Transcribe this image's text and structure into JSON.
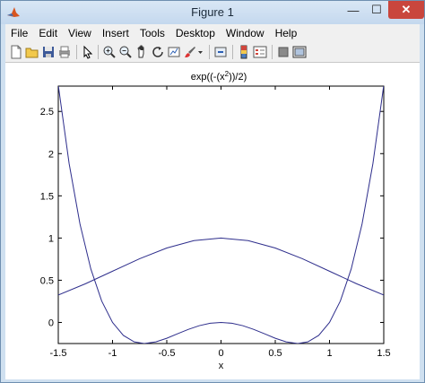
{
  "window": {
    "title": "Figure 1",
    "minimize_symbol": "—",
    "maximize_symbol": "☐",
    "close_symbol": "✕"
  },
  "menu": {
    "items": [
      "File",
      "Edit",
      "View",
      "Insert",
      "Tools",
      "Desktop",
      "Window",
      "Help"
    ]
  },
  "toolbar": {
    "buttons": [
      "new-figure-icon",
      "open-file-icon",
      "save-icon",
      "print-icon",
      "pointer-icon",
      "zoom-in-icon",
      "zoom-out-icon",
      "pan-icon",
      "rotate-icon",
      "data-cursor-icon",
      "brush-icon",
      "brush-dropdown-icon",
      "link-plot-icon",
      "colorbar-icon",
      "legend-icon",
      "hide-plot-tools-icon",
      "show-plot-tools-icon"
    ]
  },
  "chart_data": {
    "type": "line",
    "title": "exp((-(x^2))/2)",
    "title_base": "exp((-(x",
    "title_sup": "2",
    "title_tail": "))/2)",
    "xlabel": "x",
    "ylabel": "",
    "xlim": [
      -1.5,
      1.5
    ],
    "ylim": [
      -0.25,
      2.8
    ],
    "xticks": [
      -1.5,
      -1,
      -0.5,
      0,
      0.5,
      1,
      1.5
    ],
    "xtick_labels": [
      "-1.5",
      "-1",
      "-0.5",
      "0",
      "0.5",
      "1",
      "1.5"
    ],
    "yticks": [
      0,
      0.5,
      1,
      1.5,
      2,
      2.5
    ],
    "ytick_labels": [
      "0",
      "0.5",
      "1",
      "1.5",
      "2",
      "2.5"
    ],
    "grid": false,
    "line_color": "#2e2e8c",
    "series": [
      {
        "x": [
          -1.5,
          -1.25,
          -1,
          -0.75,
          -0.5,
          -0.25,
          0,
          0.25,
          0.5,
          0.75,
          1,
          1.25,
          1.5
        ],
        "y": [
          0.325,
          0.458,
          0.607,
          0.755,
          0.882,
          0.969,
          1.0,
          0.969,
          0.882,
          0.755,
          0.607,
          0.458,
          0.325
        ]
      },
      {
        "x": [
          -1.5,
          -1.4,
          -1.3,
          -1.2,
          -1.1,
          -1.0,
          -0.9,
          -0.8,
          -0.7071,
          -0.6,
          -0.5,
          -0.4,
          -0.3,
          -0.2,
          -0.1,
          0,
          0.1,
          0.2,
          0.3,
          0.4,
          0.5,
          0.6,
          0.7071,
          0.8,
          0.9,
          1.0,
          1.1,
          1.2,
          1.3,
          1.4,
          1.5
        ],
        "y": [
          2.81,
          1.882,
          1.166,
          0.634,
          0.254,
          0.0,
          -0.154,
          -0.23,
          -0.25,
          -0.23,
          -0.1875,
          -0.134,
          -0.082,
          -0.038,
          -0.01,
          0,
          -0.01,
          -0.038,
          -0.082,
          -0.134,
          -0.1875,
          -0.23,
          -0.25,
          -0.23,
          -0.154,
          0.0,
          0.254,
          0.634,
          1.166,
          1.882,
          2.81
        ]
      }
    ]
  }
}
